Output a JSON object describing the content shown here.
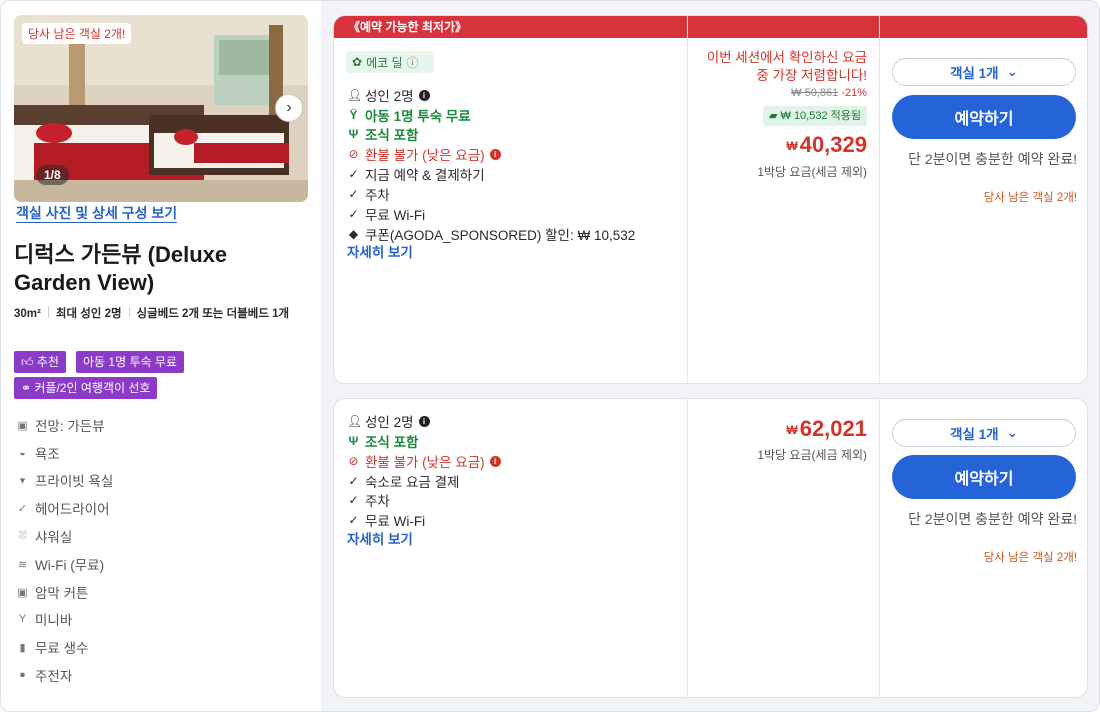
{
  "left": {
    "photo_badge": "당사 남은 객실 2개!",
    "photo_count": "1/8",
    "photos_link": "객실 사진 및 상세 구성 보기",
    "room_title": "디럭스 가든뷰 (Deluxe Garden View)",
    "meta": {
      "size": "30m²",
      "occupancy": "최대 성인 2명",
      "beds": "싱글베드 2개 또는 더블베드 1개"
    },
    "tags": [
      "추천",
      "아동 1명 투숙 무료",
      "커플/2인 여행객이 선호"
    ],
    "features": [
      {
        "icon": "view-icon",
        "label": "전망: 가든뷰"
      },
      {
        "icon": "bathtub-icon",
        "label": "욕조"
      },
      {
        "icon": "shower-icon",
        "label": "프라이빗 욕실"
      },
      {
        "icon": "check-icon",
        "label": "헤어드라이어"
      },
      {
        "icon": "showerhead-icon",
        "label": "샤워실"
      },
      {
        "icon": "wifi-icon",
        "label": "Wi-Fi (무료)"
      },
      {
        "icon": "curtain-icon",
        "label": "암막 커튼"
      },
      {
        "icon": "cocktail-icon",
        "label": "미니바"
      },
      {
        "icon": "water-bottle-icon",
        "label": "무료 생수"
      },
      {
        "icon": "kettle-icon",
        "label": "주전자"
      }
    ]
  },
  "offers": [
    {
      "band": "《예약 가능한 최저가》",
      "eco_label": "에코 딜",
      "lines": [
        {
          "icon": "person-icon",
          "text": "성인 2명",
          "style": "normal",
          "info": true
        },
        {
          "icon": "child-icon",
          "text": "아동 1명 투숙 무료",
          "style": "green"
        },
        {
          "icon": "fork-knife-icon",
          "text": "조식 포함",
          "style": "green"
        },
        {
          "icon": "no-refund-icon",
          "text": "환불 불가 (낮은 요금)",
          "style": "red",
          "info": true
        },
        {
          "icon": "check-icon",
          "text": "지금 예약 & 결제하기",
          "style": "normal"
        },
        {
          "icon": "check-icon",
          "text": "주차",
          "style": "normal"
        },
        {
          "icon": "check-icon",
          "text": "무료 Wi-Fi",
          "style": "normal"
        },
        {
          "icon": "tag-icon",
          "text": "쿠폰(AGODA_SPONSORED) 할인: ₩ 10,532",
          "style": "normal"
        }
      ],
      "more_link": "자세히 보기",
      "session_note": "이번 세션에서 확인하신 요금 중 가장 저렴합니다!",
      "original_price": "₩ 50,861",
      "discount_pct": "-21%",
      "applied": "₩ 10,532 적용됨",
      "currency": "₩",
      "price": "40,329",
      "per_night": "1박당 요금(세금 제외)",
      "room_select": "객실 1개",
      "book_label": "예약하기",
      "hurry_note": "단 2분이면 충분한 예약 완료!",
      "rooms_left": "당사 남은 객실 2개!"
    },
    {
      "lines": [
        {
          "icon": "person-icon",
          "text": "성인 2명",
          "style": "normal",
          "info": true
        },
        {
          "icon": "fork-knife-icon",
          "text": "조식 포함",
          "style": "green"
        },
        {
          "icon": "no-refund-icon",
          "text": "환불 불가 (낮은 요금)",
          "style": "red",
          "info": true
        },
        {
          "icon": "check-icon",
          "text": "숙소로 요금 결제",
          "style": "normal"
        },
        {
          "icon": "check-icon",
          "text": "주차",
          "style": "normal"
        },
        {
          "icon": "check-icon",
          "text": "무료 Wi-Fi",
          "style": "normal"
        }
      ],
      "more_link": "자세히 보기",
      "currency": "₩",
      "price": "62,021",
      "per_night": "1박당 요금(세금 제외)",
      "room_select": "객실 1개",
      "book_label": "예약하기",
      "hurry_note": "단 2분이면 충분한 예약 완료!",
      "rooms_left": "당사 남은 객실 2개!"
    }
  ],
  "colors": {
    "accent_blue": "#2563d9",
    "price_red": "#d0342c",
    "tag_purple": "#8b3bc7",
    "green": "#1a8a3a"
  }
}
